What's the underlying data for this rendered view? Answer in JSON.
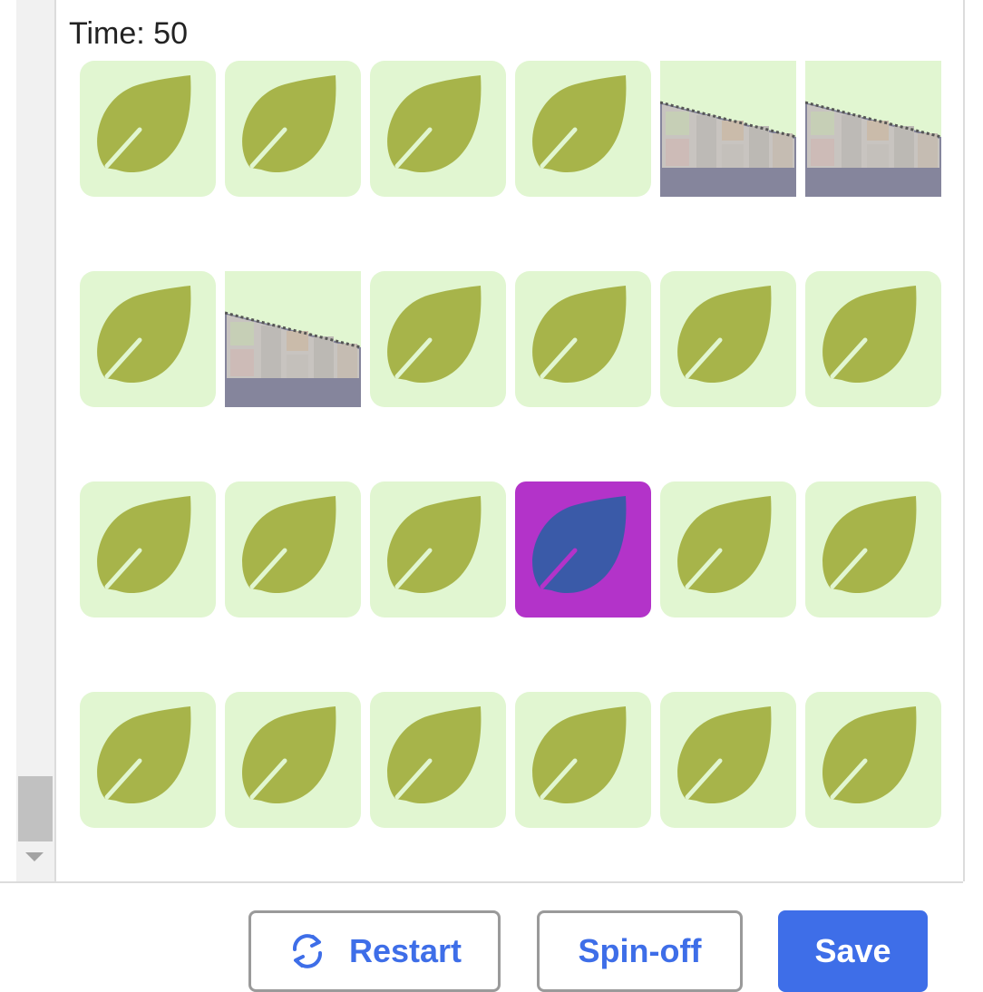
{
  "game": {
    "time_label": "Time: 50"
  },
  "board": {
    "rows": 4,
    "cols": 6,
    "cells": [
      [
        "leaf",
        "leaf",
        "leaf",
        "leaf",
        "machine",
        "machine"
      ],
      [
        "leaf",
        "machine",
        "leaf",
        "leaf",
        "leaf",
        "leaf"
      ],
      [
        "leaf",
        "leaf",
        "leaf",
        "leaf-selected",
        "leaf",
        "leaf"
      ],
      [
        "leaf",
        "leaf",
        "leaf",
        "leaf",
        "leaf",
        "leaf"
      ]
    ],
    "colors": {
      "tile_bg": "#e1f6d1",
      "leaf": "#a7b44a",
      "selected_bg": "#b333c9",
      "selected_leaf": "#3a5aa8"
    }
  },
  "footer": {
    "restart_label": "Restart",
    "spinoff_label": "Spin-off",
    "save_label": "Save",
    "restart_icon": "refresh-icon",
    "accent": "#3e6ee8"
  }
}
